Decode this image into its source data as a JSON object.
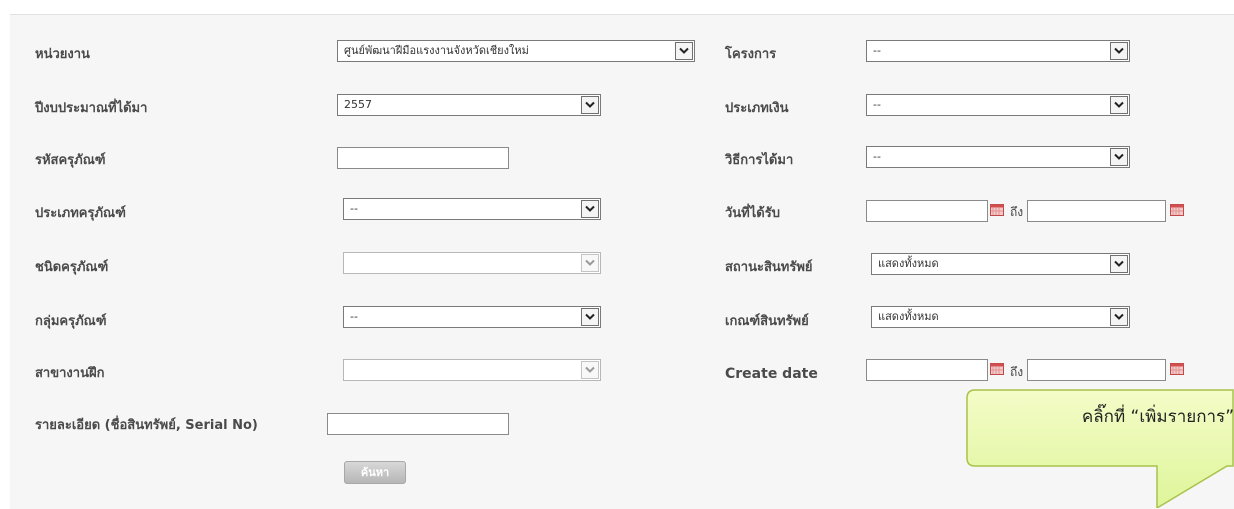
{
  "filters": {
    "unit": {
      "label": "หน่วยงาน",
      "value": "ศูนย์พัฒนาฝีมือแรงงานจังหวัดเชียงใหม่"
    },
    "fiscal_year": {
      "label": "ปีงบประมาณที่ได้มา",
      "value": "2557"
    },
    "equipment_code": {
      "label": "รหัสครุภัณฑ์",
      "value": ""
    },
    "equipment_type": {
      "label": "ประเภทครุภัณฑ์",
      "value": "--"
    },
    "equipment_kind": {
      "label": "ชนิดครุภัณฑ์",
      "value": ""
    },
    "equipment_group": {
      "label": "กลุ่มครุภัณฑ์",
      "value": "--"
    },
    "training_branch": {
      "label": "สาขางานฝึก",
      "value": ""
    },
    "details": {
      "label": "รายละเอียด (ชื่อสินทรัพย์, Serial No)",
      "value": ""
    },
    "project": {
      "label": "โครงการ",
      "value": "--"
    },
    "money_type": {
      "label": "ประเภทเงิน",
      "value": "--"
    },
    "acquire_method": {
      "label": "วิธีการได้มา",
      "value": "--"
    },
    "received_date": {
      "label": "วันที่ได้รับ",
      "from": "",
      "to": "",
      "to_label": "ถึง"
    },
    "asset_status": {
      "label": "สถานะสินทรัพย์",
      "value": "แสดงทั้งหมด"
    },
    "asset_criteria": {
      "label": "เกณฑ์สินทรัพย์",
      "value": "แสดงทั้งหมด"
    },
    "create_date": {
      "label": "Create date",
      "from": "",
      "to": "",
      "to_label": "ถึง"
    }
  },
  "search_button": "ค้นหา",
  "callout": {
    "text": "คลิ๊กที่ “เพิ่มรายการ”"
  },
  "colors": {
    "panel_bg": "#f6f6f6",
    "label": "#4a4a4a",
    "callout_fill": "#e9f8a9",
    "callout_border": "#a8c24a"
  }
}
